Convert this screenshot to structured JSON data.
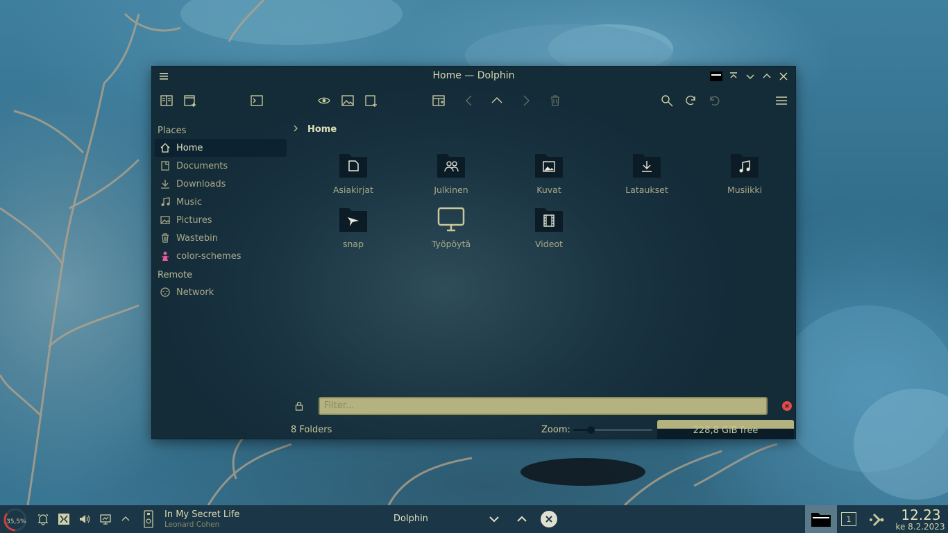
{
  "window": {
    "title": "Home — Dolphin"
  },
  "toolbar": {
    "icons": [
      "split-view-icon",
      "new-tab-icon",
      "terminal-icon",
      "preview-eye-icon",
      "image-icon",
      "new-file-icon",
      "view-layout-icon",
      "back-icon",
      "up-icon",
      "forward-icon",
      "trash-icon",
      "search-icon",
      "refresh-icon",
      "undo-icon",
      "menu-icon"
    ]
  },
  "places": {
    "title": "Places",
    "items": [
      {
        "label": "Home",
        "icon": "home-icon"
      },
      {
        "label": "Documents",
        "icon": "documents-icon"
      },
      {
        "label": "Downloads",
        "icon": "downloads-icon"
      },
      {
        "label": "Music",
        "icon": "music-icon"
      },
      {
        "label": "Pictures",
        "icon": "pictures-icon"
      },
      {
        "label": "Wastebin",
        "icon": "trash-icon"
      },
      {
        "label": "color-schemes",
        "icon": "color-schemes-icon"
      }
    ],
    "remote_title": "Remote",
    "remote_items": [
      {
        "label": "Network",
        "icon": "network-icon"
      }
    ]
  },
  "breadcrumb": {
    "current": "Home"
  },
  "files": [
    {
      "name": "Asiakirjat",
      "icon": "document-folder-icon"
    },
    {
      "name": "Julkinen",
      "icon": "public-folder-icon"
    },
    {
      "name": "Kuvat",
      "icon": "pictures-folder-icon"
    },
    {
      "name": "Lataukset",
      "icon": "downloads-folder-icon"
    },
    {
      "name": "Musiikki",
      "icon": "music-folder-icon"
    },
    {
      "name": "snap",
      "icon": "snap-folder-icon"
    },
    {
      "name": "Työpöytä",
      "icon": "desktop-icon"
    },
    {
      "name": "Videot",
      "icon": "videos-folder-icon"
    }
  ],
  "filter": {
    "placeholder": "Filter..."
  },
  "status": {
    "folders": "8 Folders",
    "zoom_label": "Zoom:",
    "disk_free": "228,8 GiB free"
  },
  "taskbar": {
    "cpu": "35,5%",
    "media_title": "In My Secret Life",
    "media_artist": "Leonard Cohen",
    "task_label": "Dolphin",
    "desktop_number": "1",
    "clock": "12.23",
    "date": "ke 8.2.2023"
  },
  "colors": {
    "accent": "#b4b27e",
    "window_bg": "#1a3442",
    "taskbar_bg": "#1b3646",
    "close_red": "#e04a4a"
  }
}
